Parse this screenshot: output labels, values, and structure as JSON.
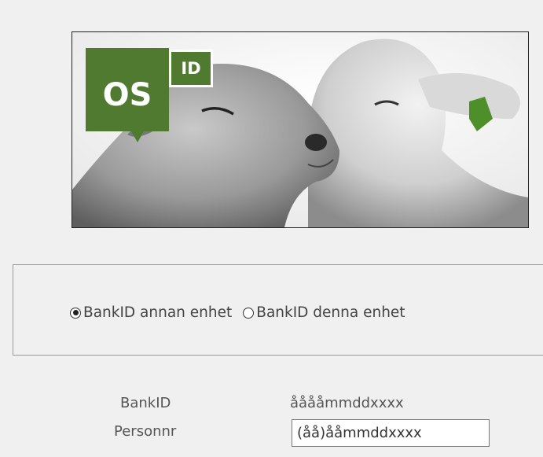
{
  "logo": {
    "main_text": "OS",
    "badge_text": "ID",
    "color": "#4f7a2f"
  },
  "auth_methods": {
    "options": [
      {
        "label": "BankID annan enhet",
        "selected": true
      },
      {
        "label": "BankID denna enhet",
        "selected": false
      }
    ]
  },
  "form": {
    "label_line1": "BankID",
    "label_line2": "Personnr",
    "format_hint": "ååååmmddxxxx",
    "personnr_placeholder": "(åå)ååmmddxxxx"
  }
}
